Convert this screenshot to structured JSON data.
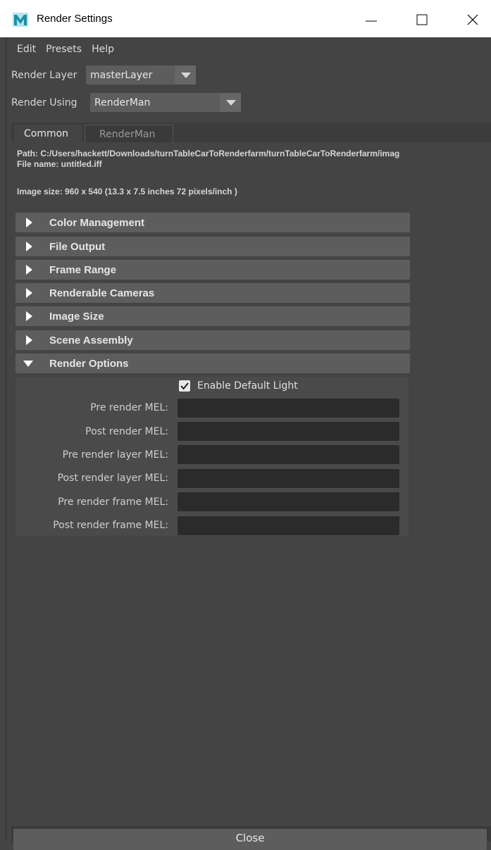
{
  "window": {
    "title": "Render Settings"
  },
  "menu": [
    "Edit",
    "Presets",
    "Help"
  ],
  "render_layer": {
    "label": "Render Layer",
    "value": "masterLayer"
  },
  "render_using": {
    "label": "Render Using",
    "value": "RenderMan"
  },
  "tabs": [
    {
      "label": "Common",
      "selected": true
    },
    {
      "label": "RenderMan",
      "selected": false
    }
  ],
  "info": {
    "path": "Path: C:/Users/hackett/Downloads/turnTableCarToRenderfarm/turnTableCarToRenderfarm/imag",
    "file_name": "File name:  untitled.iff",
    "image_size": "Image size: 960 x 540 (13.3 x 7.5 inches 72 pixels/inch )"
  },
  "sections": [
    {
      "label": "Color Management",
      "expanded": false
    },
    {
      "label": "File Output",
      "expanded": false
    },
    {
      "label": "Frame Range",
      "expanded": false
    },
    {
      "label": "Renderable Cameras",
      "expanded": false
    },
    {
      "label": "Image Size",
      "expanded": false
    },
    {
      "label": "Scene Assembly",
      "expanded": false
    },
    {
      "label": "Render Options",
      "expanded": true
    }
  ],
  "render_options": {
    "enable_default_light": {
      "label": "Enable Default Light",
      "checked": true
    },
    "mel_fields": [
      {
        "label": "Pre render MEL:",
        "value": ""
      },
      {
        "label": "Post render MEL:",
        "value": ""
      },
      {
        "label": "Pre render layer MEL:",
        "value": ""
      },
      {
        "label": "Post render layer MEL:",
        "value": ""
      },
      {
        "label": "Pre render frame MEL:",
        "value": ""
      },
      {
        "label": "Post render frame MEL:",
        "value": ""
      }
    ]
  },
  "close_label": "Close",
  "colors": {
    "accent": "#2aa3b8",
    "panel": "#444444",
    "header": "#5d5d5d",
    "field": "#2b2b2b"
  },
  "icons": [
    "maya-logo-icon",
    "minimize-icon",
    "maximize-icon",
    "close-icon",
    "expand-arrow-icon",
    "collapse-arrow-icon",
    "dropdown-arrow-icon",
    "checkmark-icon"
  ]
}
